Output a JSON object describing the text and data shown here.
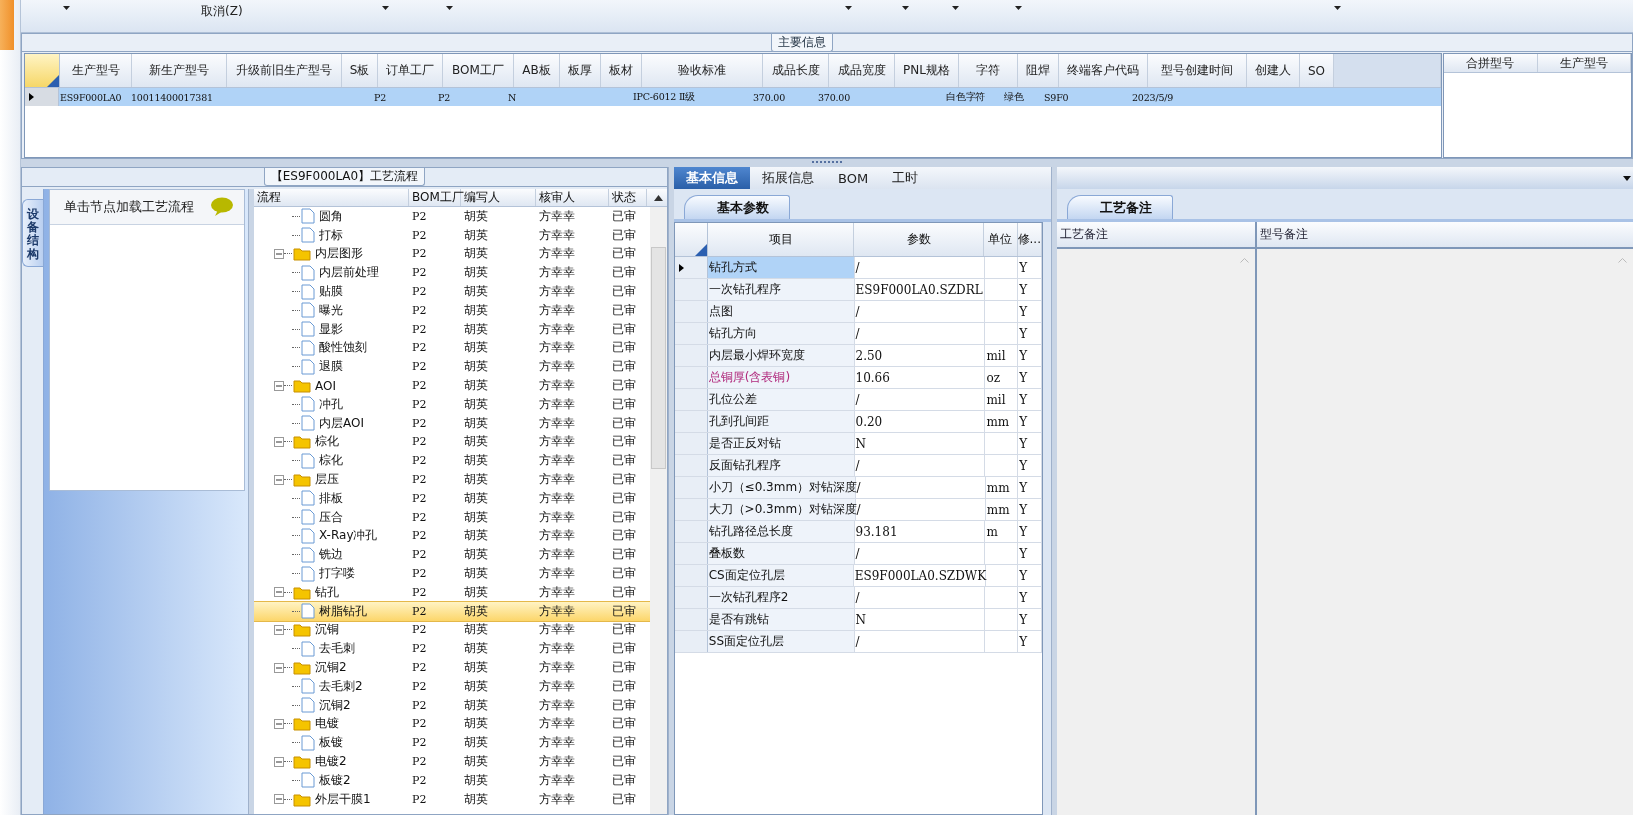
{
  "toolbar": {
    "items": [
      {
        "label": "取消(Z)"
      }
    ]
  },
  "main_info": {
    "title": "主要信息",
    "columns": [
      "生产型号",
      "新生产型号",
      "升级前旧生产型号",
      "S板",
      "订单工厂",
      "BOM工厂",
      "AB板",
      "板厚",
      "板材",
      "验收标准",
      "成品长度",
      "成品宽度",
      "PNL规格",
      "字符",
      "阻焊",
      "终端客户代码",
      "型号创建时间",
      "创建人",
      "SO"
    ],
    "rows": [
      {
        "selected": true,
        "cells": [
          "ES9F000LA0",
          "10011400017381",
          "",
          "",
          "P2",
          "P2",
          "N",
          "",
          "",
          "IPC-6012 Ⅱ级",
          "370.00",
          "370.00",
          "",
          "白色字符",
          "绿色",
          "S9F0",
          "2023/5/9",
          "",
          ""
        ]
      }
    ],
    "merge_columns": [
      "合拼型号",
      "生产型号"
    ]
  },
  "process_panel": {
    "title": "【ES9F000LA0】工艺流程",
    "side_tab": "设备结构",
    "hint": "单击节点加载工艺流程",
    "columns": [
      "流程",
      "BOM工厂",
      "编写人",
      "核审人",
      "状态"
    ],
    "tree": [
      {
        "kind": "file",
        "label": "圆角",
        "bom": "P2",
        "writer": "胡英",
        "reviewer": "方幸幸",
        "status": "已审",
        "selected": false
      },
      {
        "kind": "file",
        "label": "打标",
        "bom": "P2",
        "writer": "胡英",
        "reviewer": "方幸幸",
        "status": "已审",
        "selected": false
      },
      {
        "kind": "folder",
        "expanded": true,
        "label": "内层图形",
        "bom": "P2",
        "writer": "胡英",
        "reviewer": "方幸幸",
        "status": "已审",
        "selected": false,
        "children": [
          {
            "kind": "file",
            "label": "内层前处理",
            "bom": "P2",
            "writer": "胡英",
            "reviewer": "方幸幸",
            "status": "已审",
            "selected": false
          },
          {
            "kind": "file",
            "label": "贴膜",
            "bom": "P2",
            "writer": "胡英",
            "reviewer": "方幸幸",
            "status": "已审",
            "selected": false
          },
          {
            "kind": "file",
            "label": "曝光",
            "bom": "P2",
            "writer": "胡英",
            "reviewer": "方幸幸",
            "status": "已审",
            "selected": false
          },
          {
            "kind": "file",
            "label": "显影",
            "bom": "P2",
            "writer": "胡英",
            "reviewer": "方幸幸",
            "status": "已审",
            "selected": false
          },
          {
            "kind": "file",
            "label": "酸性蚀刻",
            "bom": "P2",
            "writer": "胡英",
            "reviewer": "方幸幸",
            "status": "已审",
            "selected": false
          },
          {
            "kind": "file",
            "label": "退膜",
            "bom": "P2",
            "writer": "胡英",
            "reviewer": "方幸幸",
            "status": "已审",
            "selected": false
          }
        ]
      },
      {
        "kind": "folder",
        "expanded": true,
        "label": "AOI",
        "bom": "P2",
        "writer": "胡英",
        "reviewer": "方幸幸",
        "status": "已审",
        "selected": false,
        "children": [
          {
            "kind": "file",
            "label": "冲孔",
            "bom": "P2",
            "writer": "胡英",
            "reviewer": "方幸幸",
            "status": "已审",
            "selected": false
          },
          {
            "kind": "file",
            "label": "内层AOI",
            "bom": "P2",
            "writer": "胡英",
            "reviewer": "方幸幸",
            "status": "已审",
            "selected": false
          }
        ]
      },
      {
        "kind": "folder",
        "expanded": true,
        "label": "棕化",
        "bom": "P2",
        "writer": "胡英",
        "reviewer": "方幸幸",
        "status": "已审",
        "selected": false,
        "children": [
          {
            "kind": "file",
            "label": "棕化",
            "bom": "P2",
            "writer": "胡英",
            "reviewer": "方幸幸",
            "status": "已审",
            "selected": false
          }
        ]
      },
      {
        "kind": "folder",
        "expanded": true,
        "label": "层压",
        "bom": "P2",
        "writer": "胡英",
        "reviewer": "方幸幸",
        "status": "已审",
        "selected": false,
        "children": [
          {
            "kind": "file",
            "label": "排板",
            "bom": "P2",
            "writer": "胡英",
            "reviewer": "方幸幸",
            "status": "已审",
            "selected": false
          },
          {
            "kind": "file",
            "label": "压合",
            "bom": "P2",
            "writer": "胡英",
            "reviewer": "方幸幸",
            "status": "已审",
            "selected": false
          },
          {
            "kind": "file",
            "label": "X-Ray冲孔",
            "bom": "P2",
            "writer": "胡英",
            "reviewer": "方幸幸",
            "status": "已审",
            "selected": false
          },
          {
            "kind": "file",
            "label": "铣边",
            "bom": "P2",
            "writer": "胡英",
            "reviewer": "方幸幸",
            "status": "已审",
            "selected": false
          },
          {
            "kind": "file",
            "label": "打字喽",
            "bom": "P2",
            "writer": "胡英",
            "reviewer": "方幸幸",
            "status": "已审",
            "selected": false
          }
        ]
      },
      {
        "kind": "folder",
        "expanded": true,
        "label": "钻孔",
        "bom": "P2",
        "writer": "胡英",
        "reviewer": "方幸幸",
        "status": "已审",
        "selected": false,
        "children": [
          {
            "kind": "file",
            "label": "树脂钻孔",
            "bom": "P2",
            "writer": "胡英",
            "reviewer": "方幸幸",
            "status": "已审",
            "selected": true
          }
        ]
      },
      {
        "kind": "folder",
        "expanded": true,
        "label": "沉铜",
        "bom": "P2",
        "writer": "胡英",
        "reviewer": "方幸幸",
        "status": "已审",
        "selected": false,
        "children": [
          {
            "kind": "file",
            "label": "去毛刺",
            "bom": "P2",
            "writer": "胡英",
            "reviewer": "方幸幸",
            "status": "已审",
            "selected": false
          }
        ]
      },
      {
        "kind": "folder",
        "expanded": true,
        "label": "沉铜2",
        "bom": "P2",
        "writer": "胡英",
        "reviewer": "方幸幸",
        "status": "已审",
        "selected": false,
        "children": [
          {
            "kind": "file",
            "label": "去毛刺2",
            "bom": "P2",
            "writer": "胡英",
            "reviewer": "方幸幸",
            "status": "已审",
            "selected": false
          },
          {
            "kind": "file",
            "label": "沉铜2",
            "bom": "P2",
            "writer": "胡英",
            "reviewer": "方幸幸",
            "status": "已审",
            "selected": false
          }
        ]
      },
      {
        "kind": "folder",
        "expanded": true,
        "label": "电镀",
        "bom": "P2",
        "writer": "胡英",
        "reviewer": "方幸幸",
        "status": "已审",
        "selected": false,
        "children": [
          {
            "kind": "file",
            "label": "板镀",
            "bom": "P2",
            "writer": "胡英",
            "reviewer": "方幸幸",
            "status": "已审",
            "selected": false
          }
        ]
      },
      {
        "kind": "folder",
        "expanded": true,
        "label": "电镀2",
        "bom": "P2",
        "writer": "胡英",
        "reviewer": "方幸幸",
        "status": "已审",
        "selected": false,
        "children": [
          {
            "kind": "file",
            "label": "板镀2",
            "bom": "P2",
            "writer": "胡英",
            "reviewer": "方幸幸",
            "status": "已审",
            "selected": false
          }
        ]
      },
      {
        "kind": "folder",
        "expanded": true,
        "label": "外层干膜1",
        "bom": "P2",
        "writer": "胡英",
        "reviewer": "方幸幸",
        "status": "已审",
        "selected": false
      }
    ]
  },
  "detail_tabs": [
    {
      "label": "基本信息",
      "selected": true
    },
    {
      "label": "拓展信息",
      "selected": false
    },
    {
      "label": "BOM",
      "selected": false
    },
    {
      "label": "工时",
      "selected": false
    }
  ],
  "params": {
    "tab": "基本参数",
    "columns": [
      "项目",
      "参数",
      "单位",
      "修..."
    ],
    "rows": [
      {
        "item": "钻孔方式",
        "value": "/",
        "unit": "",
        "flag": "Y",
        "selected": true,
        "highlight": false
      },
      {
        "item": "一次钻孔程序",
        "value": "ES9F000LA0.SZDRL",
        "unit": "",
        "flag": "Y",
        "selected": false,
        "highlight": false
      },
      {
        "item": "点图",
        "value": "/",
        "unit": "",
        "flag": "Y",
        "selected": false,
        "highlight": false
      },
      {
        "item": "钻孔方向",
        "value": "/",
        "unit": "",
        "flag": "Y",
        "selected": false,
        "highlight": false
      },
      {
        "item": "内层最小焊环宽度",
        "value": "2.50",
        "unit": "mil",
        "flag": "Y",
        "selected": false,
        "highlight": false
      },
      {
        "item": "总铜厚(含表铜)",
        "value": "10.66",
        "unit": "oz",
        "flag": "Y",
        "selected": false,
        "highlight": true
      },
      {
        "item": "孔位公差",
        "value": "/",
        "unit": "mil",
        "flag": "Y",
        "selected": false,
        "highlight": false
      },
      {
        "item": "孔到孔间距",
        "value": "0.20",
        "unit": "mm",
        "flag": "Y",
        "selected": false,
        "highlight": false
      },
      {
        "item": "是否正反对钻",
        "value": "N",
        "unit": "",
        "flag": "Y",
        "selected": false,
        "highlight": false
      },
      {
        "item": "反面钻孔程序",
        "value": "/",
        "unit": "",
        "flag": "Y",
        "selected": false,
        "highlight": false
      },
      {
        "item": "小刀（≤0.3mm）对钻深度",
        "value": "/",
        "unit": "mm",
        "flag": "Y",
        "selected": false,
        "highlight": false
      },
      {
        "item": "大刀（>0.3mm）对钻深度",
        "value": "/",
        "unit": "mm",
        "flag": "Y",
        "selected": false,
        "highlight": false
      },
      {
        "item": "钻孔路径总长度",
        "value": "93.181",
        "unit": "m",
        "flag": "Y",
        "selected": false,
        "highlight": false
      },
      {
        "item": "叠板数",
        "value": "/",
        "unit": "",
        "flag": "Y",
        "selected": false,
        "highlight": false
      },
      {
        "item": "CS面定位孔层",
        "value": "ES9F000LA0.SZDWK",
        "unit": "",
        "flag": "Y",
        "selected": false,
        "highlight": false
      },
      {
        "item": "一次钻孔程序2",
        "value": "/",
        "unit": "",
        "flag": "Y",
        "selected": false,
        "highlight": false
      },
      {
        "item": "是否有跳钻",
        "value": "N",
        "unit": "",
        "flag": "Y",
        "selected": false,
        "highlight": false
      },
      {
        "item": "SS面定位孔层",
        "value": "/",
        "unit": "",
        "flag": "Y",
        "selected": false,
        "highlight": false
      }
    ]
  },
  "notes": {
    "tab": "工艺备注",
    "columns": [
      "工艺备注",
      "型号备注"
    ]
  }
}
